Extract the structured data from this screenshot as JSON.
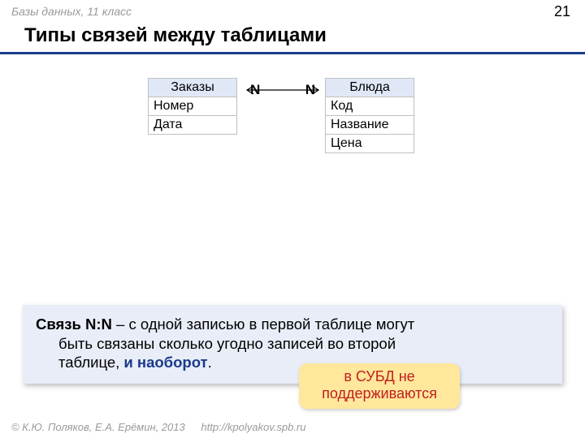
{
  "header": {
    "breadcrumb": "Базы данных, 11 класс",
    "page_number": "21"
  },
  "title": "Типы связей между таблицами",
  "tables": {
    "left": {
      "name": "Заказы",
      "fields": [
        "Номер",
        "Дата"
      ]
    },
    "right": {
      "name": "Блюда",
      "fields": [
        "Код",
        "Название",
        "Цена"
      ]
    }
  },
  "relation": {
    "left_card": "N",
    "right_card": "N"
  },
  "definition": {
    "term": "Связь N:N",
    "body1": " – с одной записью в первой таблице могут",
    "body2": "быть связаны сколько угодно записей во второй",
    "body3": "таблице, ",
    "emph": "и наоборот",
    "period": "."
  },
  "callout": {
    "line1": "в СУБД не",
    "line2": "поддерживаются"
  },
  "footer": {
    "copyright": "© К.Ю. Поляков, Е.А. Ерёмин, 2013",
    "url": "http://kpolyakov.spb.ru"
  }
}
